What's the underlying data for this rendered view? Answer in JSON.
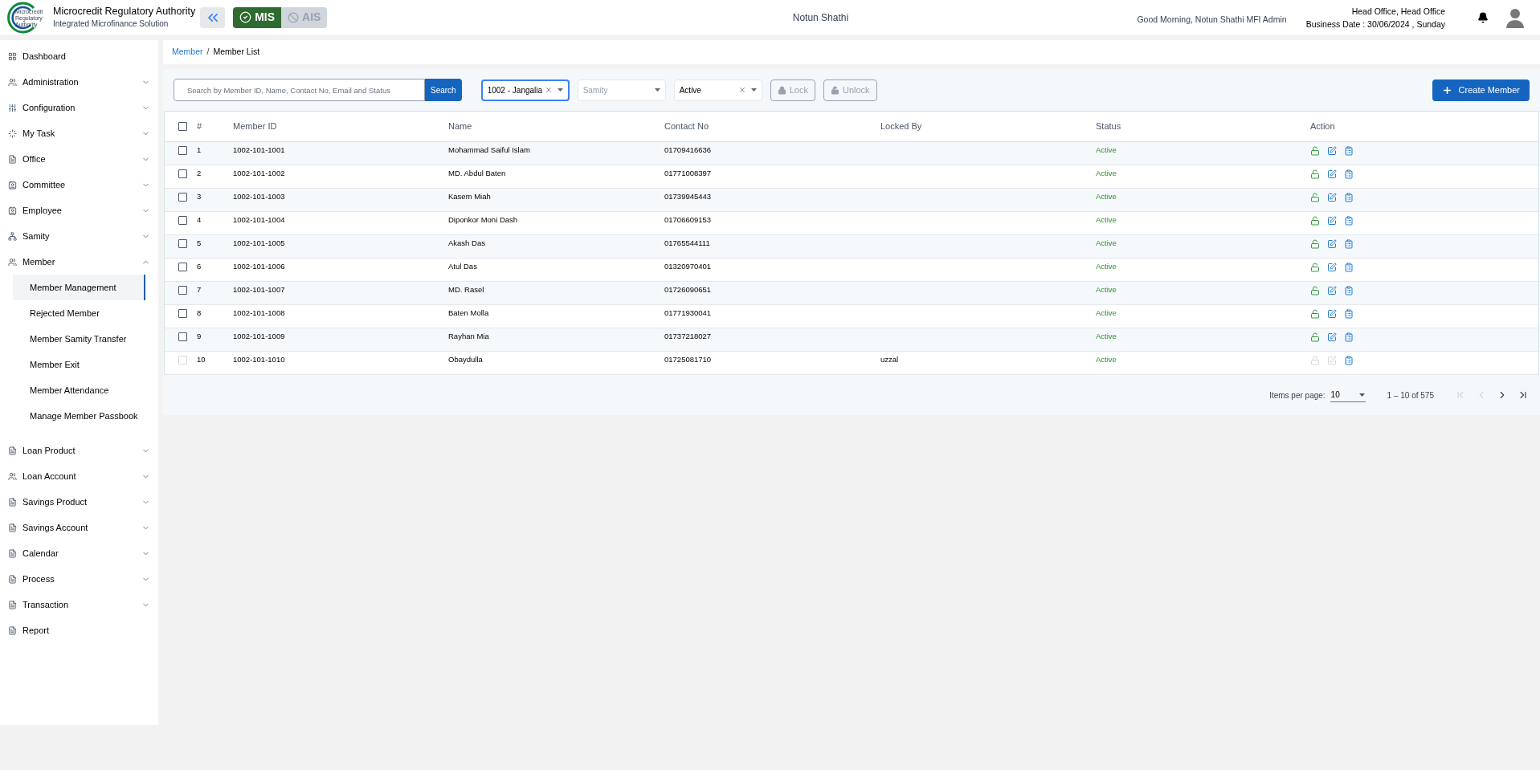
{
  "header": {
    "logo_lines": [
      "Microcredit",
      "Regulatory",
      "Authority"
    ],
    "title": "Microcredit Regulatory Authority",
    "subtitle": "Integrated Microfinance Solution",
    "modules": [
      {
        "label": "MIS",
        "selected": true
      },
      {
        "label": "AIS",
        "selected": false
      }
    ],
    "org_name": "Notun Shathi",
    "greeting": "Good Morning, Notun Shathi MFI Admin",
    "office": "Head Office, Head Office",
    "business_date": "Business Date : 30/06/2024 , Sunday"
  },
  "sidebar": {
    "items": [
      {
        "label": "Dashboard",
        "has_children": false
      },
      {
        "label": "Administration",
        "has_children": true,
        "expanded": false
      },
      {
        "label": "Configuration",
        "has_children": true,
        "expanded": false
      },
      {
        "label": "My Task",
        "has_children": true,
        "expanded": false
      },
      {
        "label": "Office",
        "has_children": true,
        "expanded": false
      },
      {
        "label": "Committee",
        "has_children": true,
        "expanded": false
      },
      {
        "label": "Employee",
        "has_children": true,
        "expanded": false
      },
      {
        "label": "Samity",
        "has_children": true,
        "expanded": false
      },
      {
        "label": "Member",
        "has_children": true,
        "expanded": true,
        "children": [
          {
            "label": "Member Management",
            "selected": true
          },
          {
            "label": "Rejected Member",
            "selected": false
          },
          {
            "label": "Member Samity Transfer",
            "selected": false
          },
          {
            "label": "Member Exit",
            "selected": false
          },
          {
            "label": "Member Attendance",
            "selected": false
          },
          {
            "label": "Manage Member Passbook",
            "selected": false
          }
        ]
      },
      {
        "label": "Loan Product",
        "has_children": true,
        "expanded": false
      },
      {
        "label": "Loan Account",
        "has_children": true,
        "expanded": false
      },
      {
        "label": "Savings Product",
        "has_children": true,
        "expanded": false
      },
      {
        "label": "Savings Account",
        "has_children": true,
        "expanded": false
      },
      {
        "label": "Calendar",
        "has_children": true,
        "expanded": false
      },
      {
        "label": "Process",
        "has_children": true,
        "expanded": false
      },
      {
        "label": "Transaction",
        "has_children": true,
        "expanded": false
      },
      {
        "label": "Report",
        "has_children": false
      }
    ]
  },
  "breadcrumb": {
    "parent": "Member",
    "separator": "/",
    "current": "Member List"
  },
  "toolbar": {
    "search": {
      "placeholder": "Search by Member ID, Name, Contact No, Email and Status"
    },
    "search_button": "Search",
    "selects": [
      {
        "value": "1002 - Jangalia",
        "focused": true,
        "clearable": true
      },
      {
        "placeholder": "Samity",
        "focused": false,
        "clearable": false
      },
      {
        "value": "Active",
        "focused": false,
        "clearable": true
      }
    ],
    "lock_button": {
      "label": "Lock",
      "disabled": true
    },
    "unlock_button": {
      "label": "Unlock",
      "disabled": true
    },
    "create_button": "Create Member"
  },
  "table": {
    "select_all_checked": false,
    "columns": [
      "#",
      "Member ID",
      "Name",
      "Contact No",
      "Locked By",
      "Status",
      "Action"
    ],
    "rows": [
      {
        "no": "1",
        "member_id": "1002-101-1001",
        "name": "Mohammad Saiful Islam",
        "contact": "01709416636",
        "status": "Active",
        "locked": false,
        "checked": false
      },
      {
        "no": "2",
        "member_id": "1002-101-1002",
        "name": "MD. Abdul Baten",
        "contact": "01771008397",
        "status": "Active",
        "locked": false,
        "checked": false
      },
      {
        "no": "3",
        "member_id": "1002-101-1003",
        "name": "Kasem Miah",
        "contact": "01739945443",
        "status": "Active",
        "locked": false,
        "checked": false
      },
      {
        "no": "4",
        "member_id": "1002-101-1004",
        "name": "Diponkor Moni Dash",
        "contact": "01706609153",
        "status": "Active",
        "locked": false,
        "checked": false
      },
      {
        "no": "5",
        "member_id": "1002-101-1005",
        "name": "Akash Das",
        "contact": "01765544111",
        "status": "Active",
        "locked": false,
        "checked": false
      },
      {
        "no": "6",
        "member_id": "1002-101-1006",
        "name": "Atul Das",
        "contact": "01320970401",
        "status": "Active",
        "locked": false,
        "checked": false
      },
      {
        "no": "7",
        "member_id": "1002-101-1007",
        "name": "MD. Rasel",
        "contact": "01726090651",
        "status": "Active",
        "locked": false,
        "checked": false
      },
      {
        "no": "8",
        "member_id": "1002-101-1008",
        "name": "Baten Molla",
        "contact": "01771930041",
        "status": "Active",
        "locked": false,
        "checked": false
      },
      {
        "no": "9",
        "member_id": "1002-101-1009",
        "name": "Rayhan Mia",
        "contact": "01737218027",
        "status": "Active",
        "locked": false,
        "checked": false
      },
      {
        "no": "10",
        "member_id": "1002-101-1010",
        "name": "Obaydulla",
        "contact": "01725081710",
        "locked_by": "uzzal",
        "status": "Active",
        "locked": true,
        "checked": false
      }
    ]
  },
  "pagination": {
    "items_per_page_label": "Items per page:",
    "page_size": "10",
    "range": "1 – 10 of 575",
    "first_disabled": true,
    "prev_disabled": true,
    "next_disabled": false,
    "last_disabled": false
  }
}
